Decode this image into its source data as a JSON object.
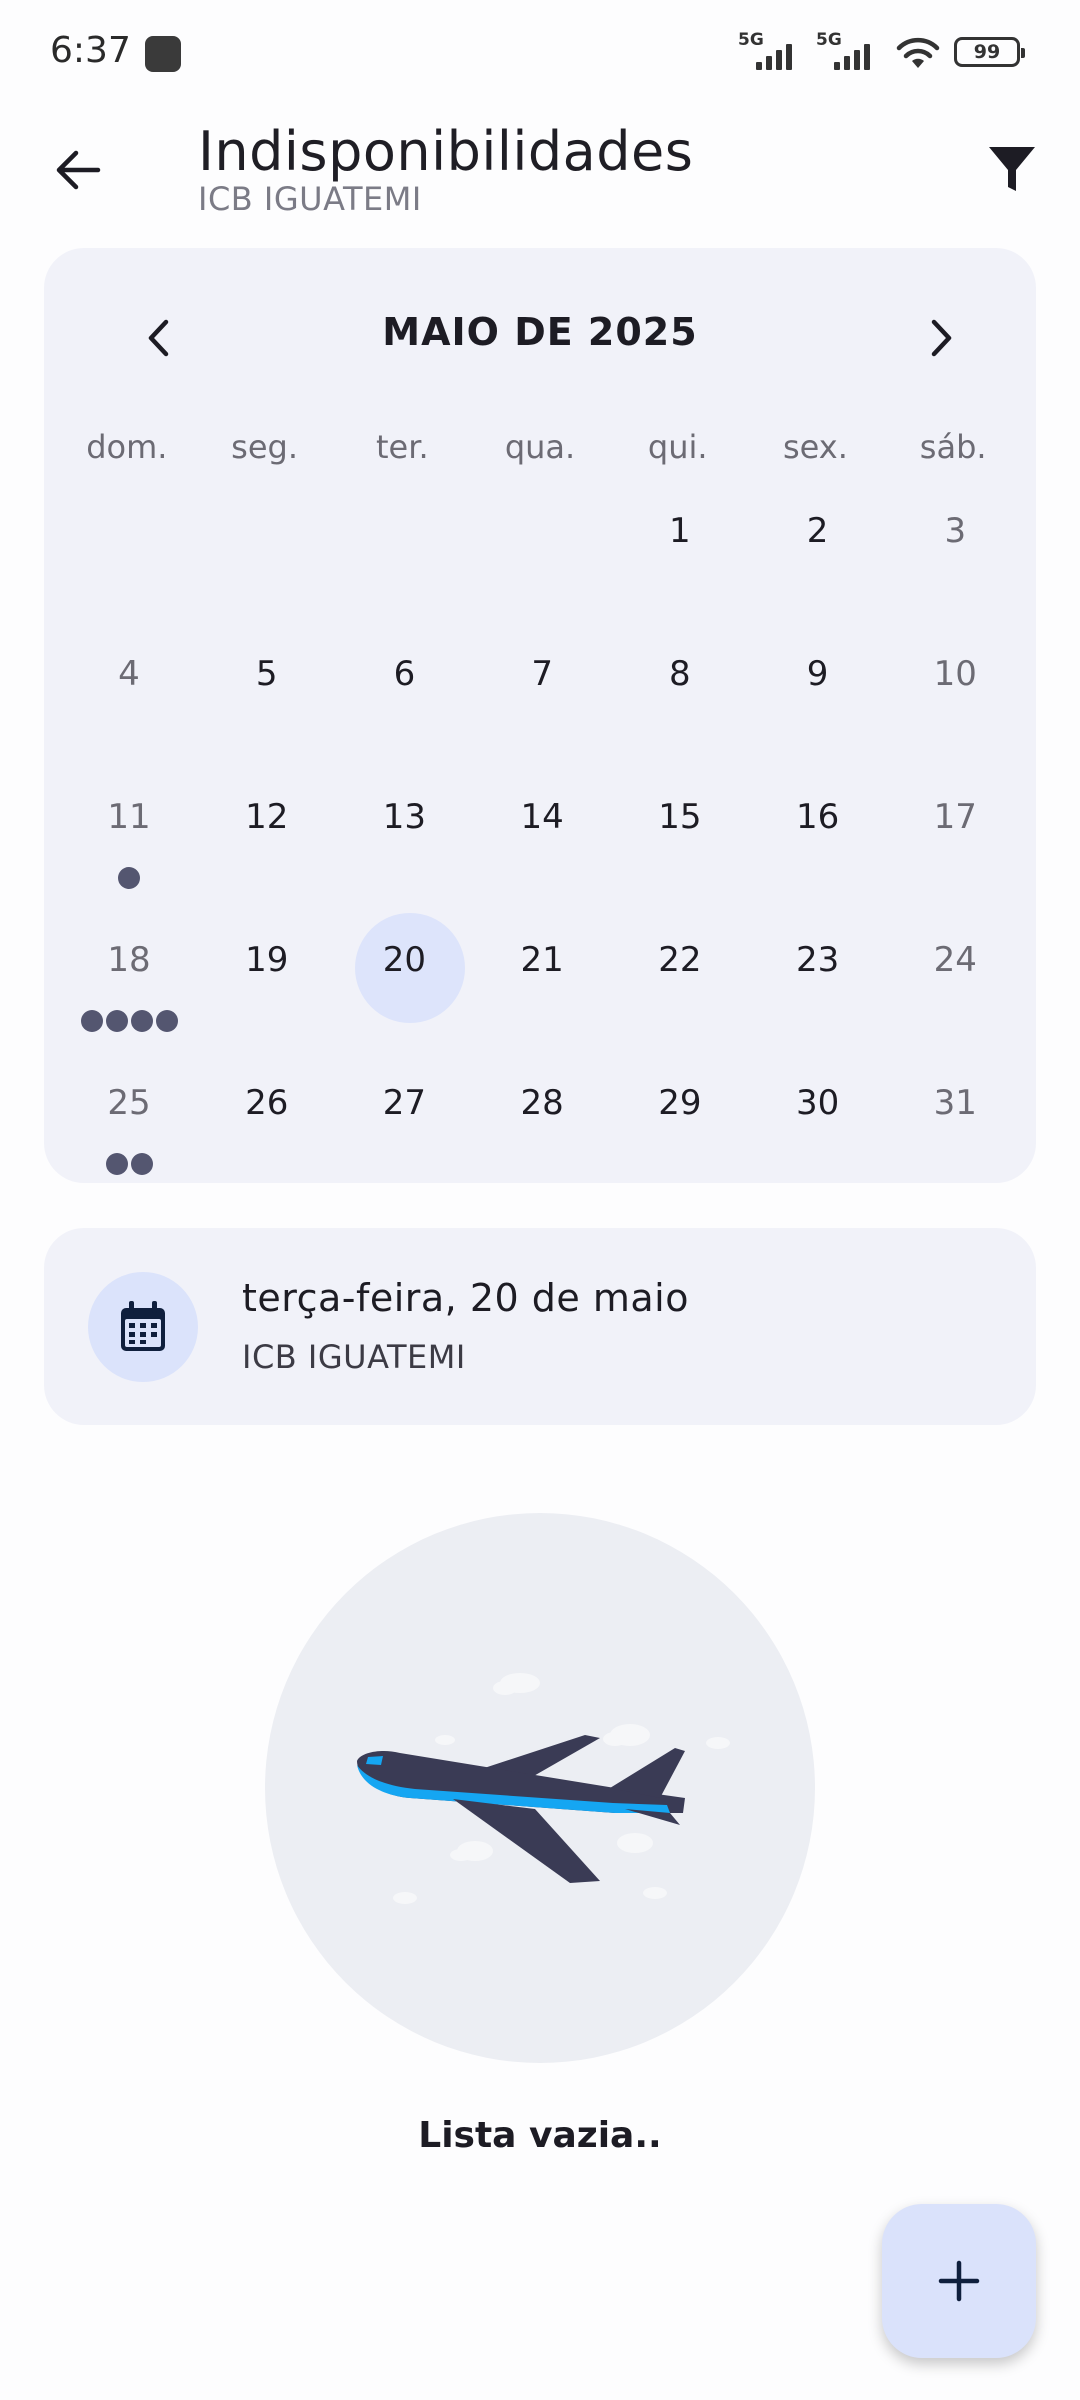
{
  "status_bar": {
    "time": "6:37",
    "network_1": "5G",
    "network_2": "5G",
    "battery": "99",
    "icons": [
      "app-notification-icon",
      "signal-icon",
      "signal-icon",
      "wifi-icon",
      "battery-icon"
    ]
  },
  "header": {
    "title": "Indisponibilidades",
    "subtitle": "ICB IGUATEMI",
    "back_icon": "arrow-left-icon",
    "filter_icon": "filter-icon"
  },
  "calendar": {
    "month_label": "MAIO DE 2025",
    "prev_icon": "chevron-left-icon",
    "next_icon": "chevron-right-icon",
    "weekdays": [
      "dom.",
      "seg.",
      "ter.",
      "qua.",
      "qui.",
      "sex.",
      "sáb."
    ],
    "weeks": [
      [
        "",
        "",
        "",
        "",
        "1",
        "2",
        "3"
      ],
      [
        "4",
        "5",
        "6",
        "7",
        "8",
        "9",
        "10"
      ],
      [
        "11",
        "12",
        "13",
        "14",
        "15",
        "16",
        "17"
      ],
      [
        "18",
        "19",
        "20",
        "21",
        "22",
        "23",
        "24"
      ],
      [
        "25",
        "26",
        "27",
        "28",
        "29",
        "30",
        "31"
      ]
    ],
    "selected_day": "20",
    "event_markers": {
      "11": 1,
      "18": 4,
      "25": 2
    },
    "colors": {
      "background": "#f1f2f9",
      "selected": "#dde4fb",
      "marker": "#545670"
    }
  },
  "selected_info": {
    "date": "terça-feira, 20 de maio",
    "unit": "ICB IGUATEMI",
    "icon": "calendar-icon"
  },
  "empty_state": {
    "illustration": "airplane-illustration",
    "message": "Lista vazia.."
  },
  "fab": {
    "icon": "plus-icon",
    "color": "#dae2fb"
  }
}
